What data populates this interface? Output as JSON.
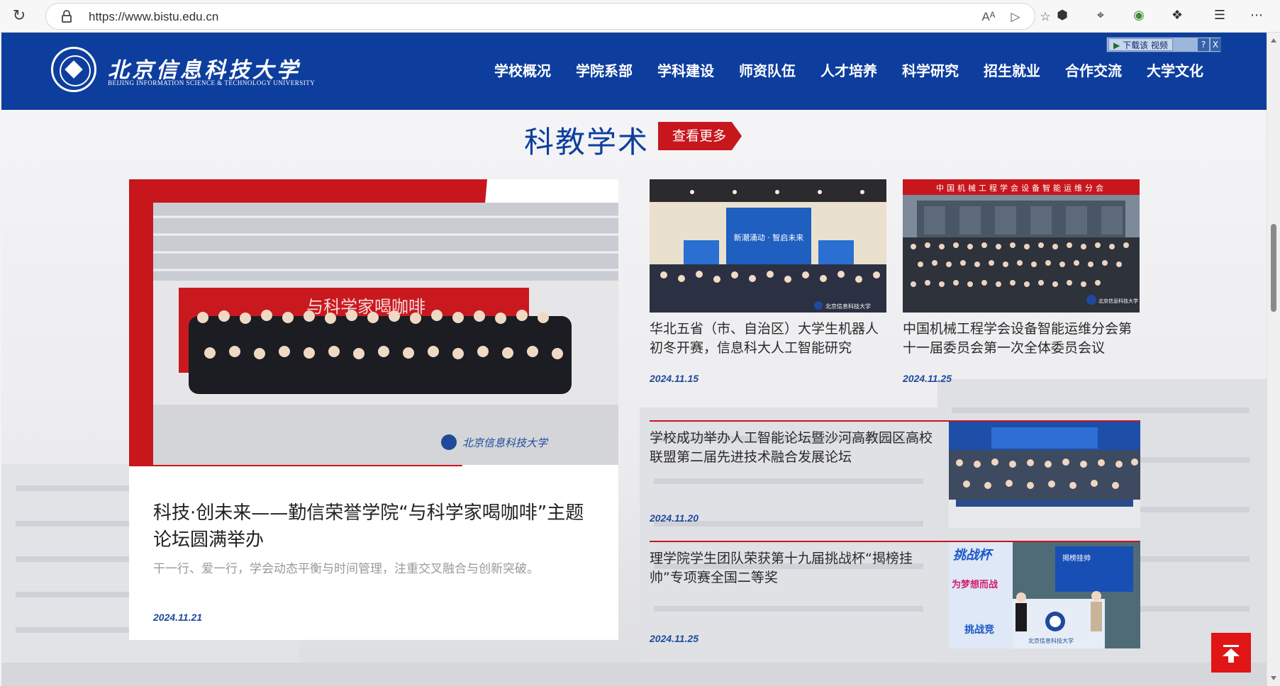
{
  "browser": {
    "url": "https://www.bistu.edu.cn",
    "read_aloud_icon": "Aᴬ",
    "icons": [
      "reload-icon",
      "lock-icon",
      "read-aloud-icon",
      "immersive-reader-icon",
      "favorite-star-icon",
      "extension-icon",
      "puzzle-icon",
      "favorites-icon",
      "more-icon"
    ]
  },
  "header": {
    "logo_cn": "北京信息科技大学",
    "logo_en": "BEIJING INFORMATION SCIENCE & TECHNOLOGY UNIVERSITY",
    "nav": [
      "学校概况",
      "学院系部",
      "学科建设",
      "师资队伍",
      "人才培养",
      "科学研究",
      "招生就业",
      "合作交流",
      "大学文化"
    ],
    "download_widget": {
      "label": "下载该 视频",
      "help": "?",
      "close": "X"
    },
    "brand_color": "#0d3e9e"
  },
  "section": {
    "title": "科教学术",
    "more_label": "查看更多",
    "accent_color": "#c8161d"
  },
  "featured": {
    "photo_banner": "与科学家喝咖啡",
    "photo_watermark": "北京信息科技大学",
    "title": "科技·创未来——勤信荣誉学院“与科学家喝咖啡”主题论坛圆满举办",
    "summary": "干一行、爱一行，学会动态平衡与时间管理，注重交叉融合与创新突破。",
    "date": "2024.11.21"
  },
  "cards": [
    {
      "photo_screen": "新潮涌动 · 智启未来",
      "photo_watermark": "北京信息科技大学",
      "title": "华北五省（市、自治区）大学生机器人初冬开赛，信息科大人工智能研究",
      "date": "2024.11.15"
    },
    {
      "photo_banner": "中国机械工程学会设备智能运维分会",
      "photo_watermark": "北京信息科技大学 新闻中心",
      "title": "中国机械工程学会设备智能运维分会第十一届委员会第一次全体委员会议",
      "date": "2024.11.25"
    }
  ],
  "rows": [
    {
      "title": "学校成功举办人工智能论坛暨沙河高教园区高校联盟第二届先进技术融合发展论坛",
      "date": "2024.11.20"
    },
    {
      "photo_labels": [
        "挑战杯",
        "为梦想而战",
        "揭榜挂帅",
        "挑战竞",
        "北京信息科技大学"
      ],
      "title": "理学院学生团队荣获第十九届挑战杯“揭榜挂帅”专项赛全国二等奖",
      "date": "2024.11.25"
    }
  ]
}
